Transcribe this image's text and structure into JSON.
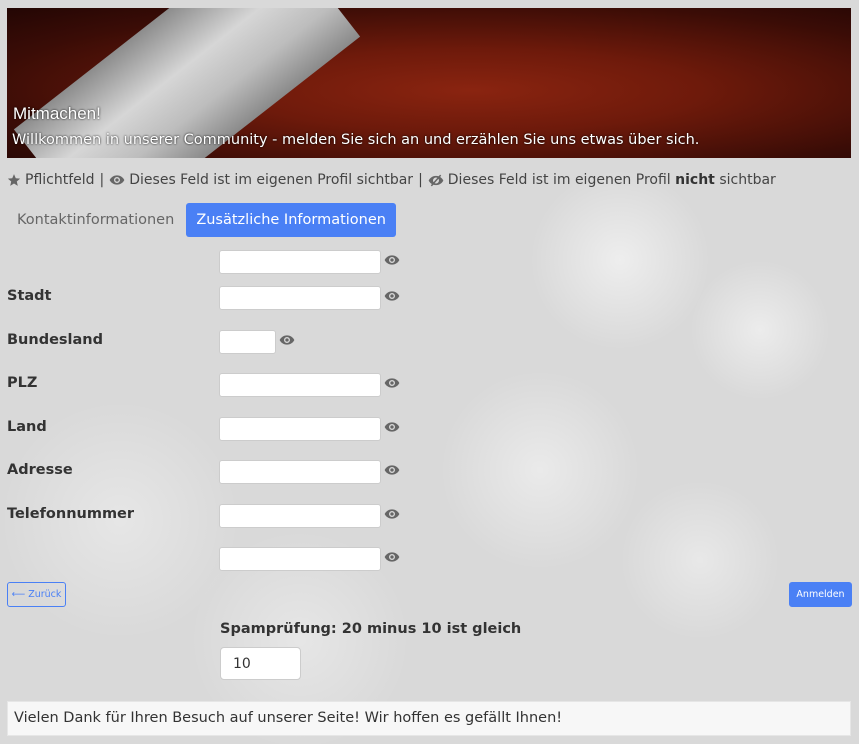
{
  "banner": {
    "title": "Mitmachen!",
    "subtitle": "Willkommen in unserer Community - melden Sie sich an und erzählen Sie uns etwas über sich."
  },
  "legend": {
    "required": "Pflichtfeld",
    "separator": "|",
    "visible": "Dieses Feld ist im eigenen Profil sichtbar",
    "hidden_prefix": "Dieses Feld ist im eigenen Profil",
    "hidden_bold": "nicht",
    "hidden_suffix": "sichtbar"
  },
  "tabs": [
    {
      "label": "Kontaktinformationen",
      "active": false
    },
    {
      "label": "Zusätzliche Informationen",
      "active": true
    }
  ],
  "form": {
    "fields": [
      {
        "label": "",
        "value": ""
      },
      {
        "label": "Stadt",
        "value": ""
      },
      {
        "label": "Bundesland",
        "value": ""
      },
      {
        "label": "PLZ",
        "value": ""
      },
      {
        "label": "Land",
        "value": ""
      },
      {
        "label": "Adresse",
        "value": ""
      },
      {
        "label": "Telefonnummer",
        "value": ""
      },
      {
        "label": "",
        "value": ""
      }
    ]
  },
  "buttons": {
    "back": "⟵ Zurück",
    "submit": "Anmelden"
  },
  "spam": {
    "label": "Spamprüfung: 20 minus 10 ist gleich",
    "value": "10"
  },
  "footer": {
    "text": "Vielen Dank für Ihren Besuch auf unserer Seite! Wir hoffen es gefällt Ihnen!"
  },
  "colors": {
    "accent": "#4a80f5",
    "banner_red": "#8a2410",
    "icon_gray": "#666666"
  },
  "icons": {
    "required": "star-icon",
    "visible": "eye-icon",
    "hidden": "eye-slash-icon"
  }
}
